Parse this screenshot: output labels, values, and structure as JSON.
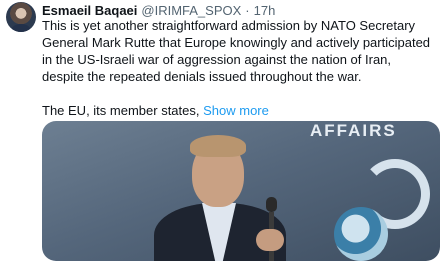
{
  "tweet": {
    "author_name": "Esmaeil Baqaei",
    "handle": "@IRIMFA_SPOX",
    "separator": "·",
    "time": "17h",
    "paragraph_1": "This is yet another straightforward admission by NATO Secretary General Mark Rutte that Europe knowingly and actively participated in the US-Israeli war of aggression against the nation of Iran, despite the repeated denials issued throughout the war.",
    "paragraph_2": "The EU, its member states, ",
    "show_more": "Show more"
  },
  "media": {
    "backdrop_text": "AFFAIRS"
  }
}
